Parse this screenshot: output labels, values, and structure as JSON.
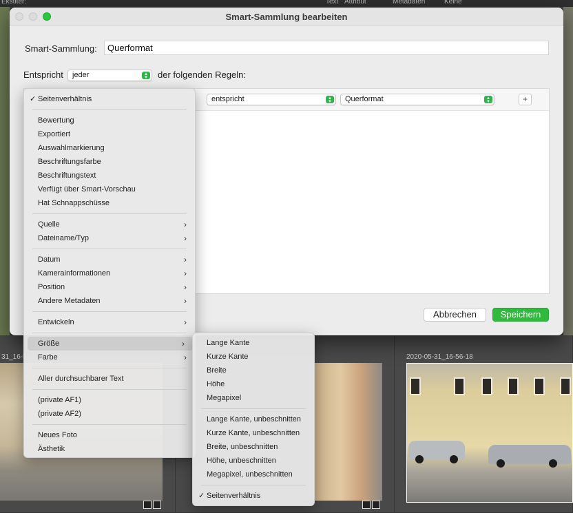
{
  "background": {
    "topbar_items": [
      "Ekstiter:",
      "Text",
      "Attribut",
      "Metadaten",
      "Keine"
    ],
    "cell_labels": [
      "31_16-5",
      "2020-05-31_16-56-18"
    ]
  },
  "dialog": {
    "title": "Smart-Sammlung bearbeiten",
    "name_label": "Smart-Sammlung:",
    "name_value": "Querformat",
    "match_prefix": "Entspricht",
    "match_value": "jeder",
    "match_suffix": "der folgenden Regeln:",
    "rule": {
      "operator": "entspricht",
      "value": "Querformat",
      "add_label": "+"
    },
    "cancel_label": "Abbrechen",
    "save_label": "Speichern"
  },
  "menu": {
    "checked_item": "Seitenverhältnis",
    "group1": [
      "Bewertung",
      "Exportiert",
      "Auswahlmarkierung",
      "Beschriftungsfarbe",
      "Beschriftungstext",
      "Verfügt über Smart-Vorschau",
      "Hat Schnappschüsse"
    ],
    "group2": [
      "Quelle",
      "Dateiname/Typ"
    ],
    "group3": [
      "Datum",
      "Kamerainformationen",
      "Position",
      "Andere Metadaten"
    ],
    "group4": [
      "Entwickeln"
    ],
    "group5": [
      "Größe",
      "Farbe"
    ],
    "group6": [
      "Aller durchsuchbarer Text"
    ],
    "group7": [
      "(private AF1)",
      "(private AF2)"
    ],
    "group8": [
      "Neues Foto",
      "Ästhetik"
    ],
    "highlighted": "Größe"
  },
  "submenu": {
    "group1": [
      "Lange Kante",
      "Kurze Kante",
      "Breite",
      "Höhe",
      "Megapixel"
    ],
    "group2": [
      "Lange Kante, unbeschnitten",
      "Kurze Kante, unbeschnitten",
      "Breite, unbeschnitten",
      "Höhe, unbeschnitten",
      "Megapixel, unbeschnitten"
    ],
    "checked_item": "Seitenverhältnis"
  },
  "colors": {
    "accent_green": "#2fba3e",
    "titlebar_max": "#2ac83f"
  }
}
